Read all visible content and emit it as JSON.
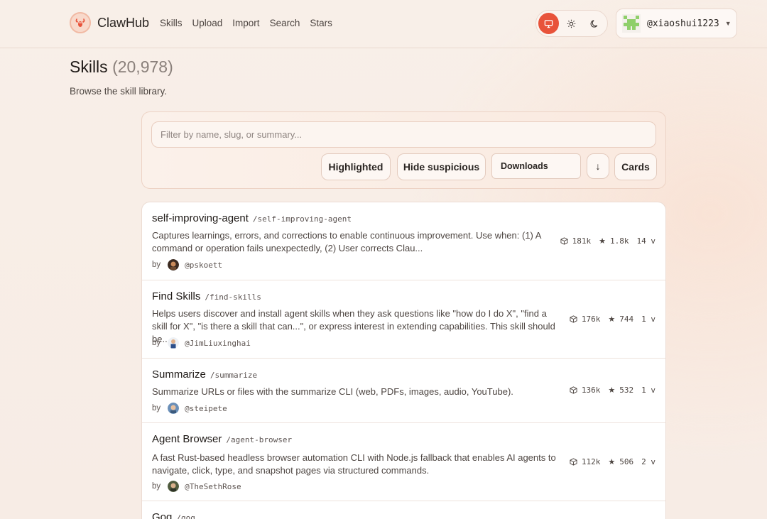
{
  "brand": {
    "name": "ClawHub"
  },
  "nav": {
    "items": [
      "Skills",
      "Upload",
      "Import",
      "Search",
      "Stars"
    ]
  },
  "theme": {
    "options": [
      "monitor-icon",
      "sun-icon",
      "moon-icon"
    ],
    "active": "monitor-icon",
    "accent": "#e8533a"
  },
  "user": {
    "handle": "@xiaoshui1223"
  },
  "page": {
    "title": "Skills",
    "count": "(20,978)",
    "subtitle": "Browse the skill library."
  },
  "filter": {
    "placeholder": "Filter by name, slug, or summary...",
    "highlighted_label": "Highlighted",
    "hide_suspicious_label": "Hide suspicious",
    "sort_value": "Downloads",
    "direction_glyph": "↓",
    "view_label": "Cards"
  },
  "skills": [
    {
      "name": "self-improving-agent",
      "slug": "/self-improving-agent",
      "description": "Captures learnings, errors, and corrections to enable continuous improvement. Use when: (1) A command or operation fails unexpectedly, (2) User corrects Clau...",
      "by": "by",
      "author": "@pskoett",
      "downloads": "181k",
      "stars": "1.8k",
      "versions": "14 v"
    },
    {
      "name": "Find Skills",
      "slug": "/find-skills",
      "description": "Helps users discover and install agent skills when they ask questions like \"how do I do X\", \"find a skill for X\", \"is there a skill that can...\", or express interest in extending capabilities. This skill should be...",
      "by": "by",
      "author": "@JimLiuxinghai",
      "downloads": "176k",
      "stars": "744",
      "versions": "1 v"
    },
    {
      "name": "Summarize",
      "slug": "/summarize",
      "description": "Summarize URLs or files with the summarize CLI (web, PDFs, images, audio, YouTube).",
      "by": "by",
      "author": "@steipete",
      "downloads": "136k",
      "stars": "532",
      "versions": "1 v"
    },
    {
      "name": "Agent Browser",
      "slug": "/agent-browser",
      "description": "A fast Rust-based headless browser automation CLI with Node.js fallback that enables AI agents to navigate, click, type, and snapshot pages via structured commands.",
      "by": "by",
      "author": "@TheSethRose",
      "downloads": "112k",
      "stars": "506",
      "versions": "2 v"
    },
    {
      "name": "Gog",
      "slug": "/gog"
    }
  ]
}
